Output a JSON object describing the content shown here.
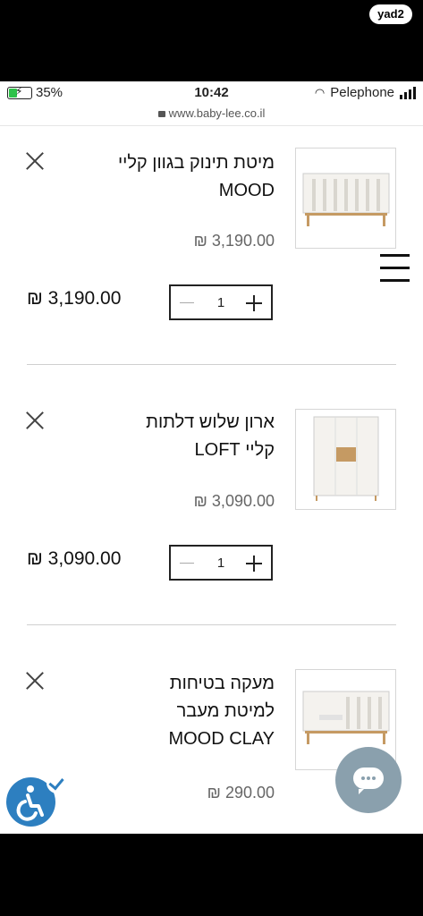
{
  "app_badge": "yad2",
  "status": {
    "battery": "35%",
    "time": "10:42",
    "carrier": "Pelephone"
  },
  "url": "www.baby-lee.co.il",
  "items": [
    {
      "title_line1": "מיטת תינוק בגוון קליי",
      "title_line2": "MOOD",
      "title_line3": "",
      "price": "₪ 3,190.00",
      "total": "₪ 3,190.00",
      "qty": "1"
    },
    {
      "title_line1": "ארון שלוש דלתות",
      "title_line2": "קליי LOFT",
      "title_line3": "",
      "price": "₪ 3,090.00",
      "total": "₪ 3,090.00",
      "qty": "1"
    },
    {
      "title_line1": "מעקה בטיחות",
      "title_line2": "למיטת מעבר",
      "title_line3": "MOOD CLAY",
      "price": "₪ 290.00",
      "total": "",
      "qty": ""
    }
  ]
}
